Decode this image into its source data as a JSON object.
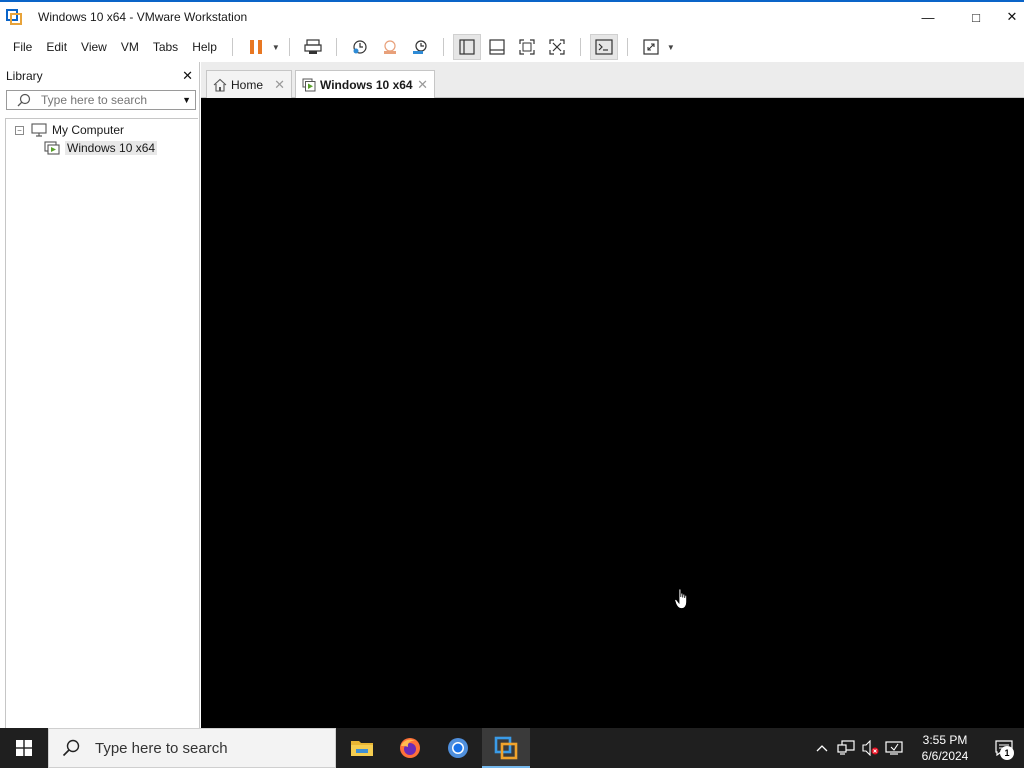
{
  "window": {
    "title": "Windows 10 x64 - VMware Workstation",
    "minimize_glyph": "—",
    "maximize_glyph": "□",
    "close_glyph": "✕"
  },
  "menu": {
    "items": [
      "File",
      "Edit",
      "View",
      "VM",
      "Tabs",
      "Help"
    ]
  },
  "toolbar": {
    "icons": [
      "pause-icon",
      "send-ctrl-alt-del-icon",
      "snapshot-icon",
      "revert-snapshot-icon",
      "snapshot-manager-icon",
      "show-library-icon",
      "thumbnail-bar-icon",
      "full-screen-icon",
      "unity-icon",
      "console-view-icon",
      "stretch-guest-icon"
    ]
  },
  "library": {
    "title": "Library",
    "close_glyph": "✕",
    "search_placeholder": "Type here to search",
    "tree": {
      "root_label": "My Computer",
      "toggle_glyph": "−",
      "child_label": "Windows 10 x64"
    }
  },
  "tabs": [
    {
      "label": "Home",
      "close_glyph": "✕"
    },
    {
      "label": "Windows 10 x64",
      "close_glyph": "✕"
    }
  ],
  "taskbar": {
    "search_text": "Type here to search",
    "apps": [
      "file-explorer-icon",
      "firefox-icon",
      "chrome-icon",
      "vmware-icon"
    ],
    "time": "3:55 PM",
    "date": "6/6/2024",
    "notification_count": "1"
  },
  "colors": {
    "accent": "#0a64c8",
    "pause_orange": "#e87722",
    "vm_green": "#5aa02c",
    "taskbar_bg": "#1f1f1f"
  }
}
